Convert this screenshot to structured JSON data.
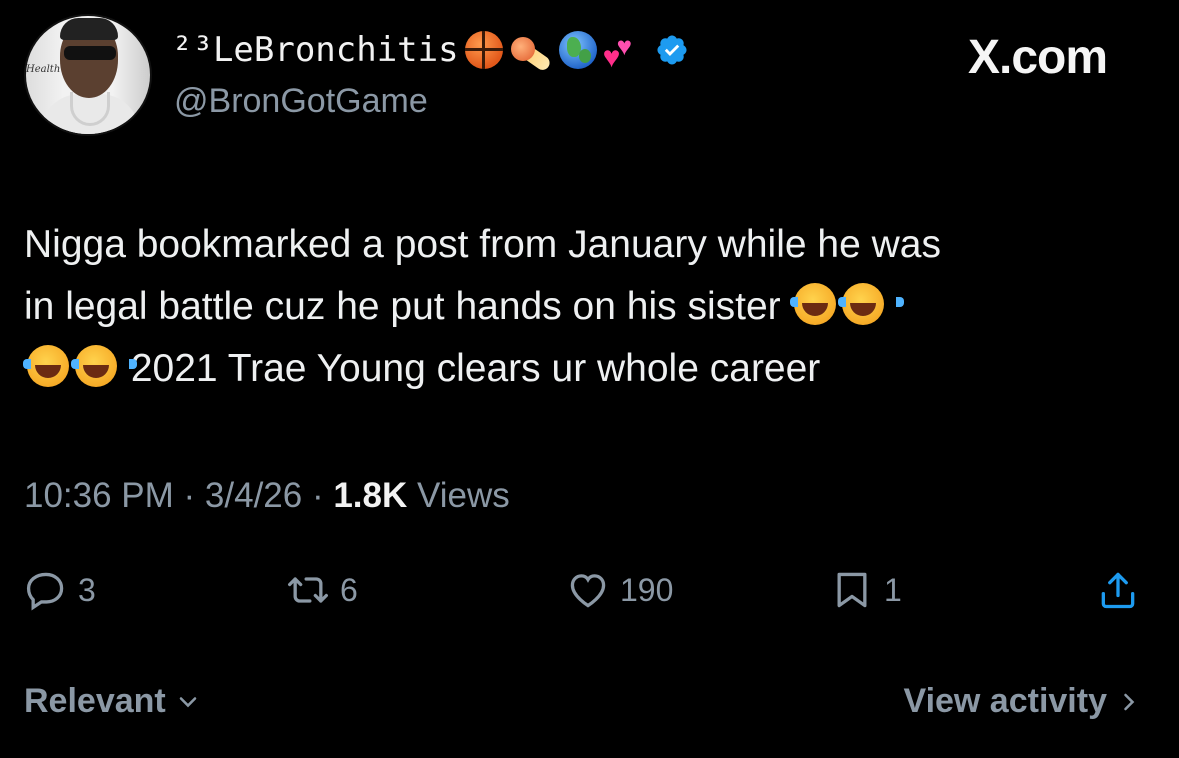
{
  "author": {
    "display_name": "²³LeBronchitis",
    "handle": "@BronGotGame",
    "emoji_icons": [
      "basketball-icon",
      "comet-icon",
      "globe-icon",
      "two-hearts-icon"
    ],
    "verified_icon": "verified-badge-icon",
    "verified_color": "#1d9bf0",
    "avatar_caption": "Health"
  },
  "brand": {
    "logo_text": "X.com"
  },
  "tweet": {
    "line1": "Nigga bookmarked a post from January while he was",
    "line2": "in legal battle cuz he put hands on his sister",
    "line3": "2021 Trae Young clears ur whole career",
    "emoji": "laughing-tears-icon"
  },
  "meta": {
    "time": "10:36 PM",
    "sep1": " · ",
    "date": "3/4/26",
    "sep2": " · ",
    "views_count": "1.8K",
    "views_label": " Views"
  },
  "actions": {
    "replies": "3",
    "reposts": "6",
    "likes": "190",
    "bookmarks": "1"
  },
  "footer": {
    "sort_label": "Relevant",
    "activity_label": "View activity"
  },
  "colors": {
    "background": "#000000",
    "text": "#e7e9ea",
    "secondary": "#8b98a5"
  }
}
